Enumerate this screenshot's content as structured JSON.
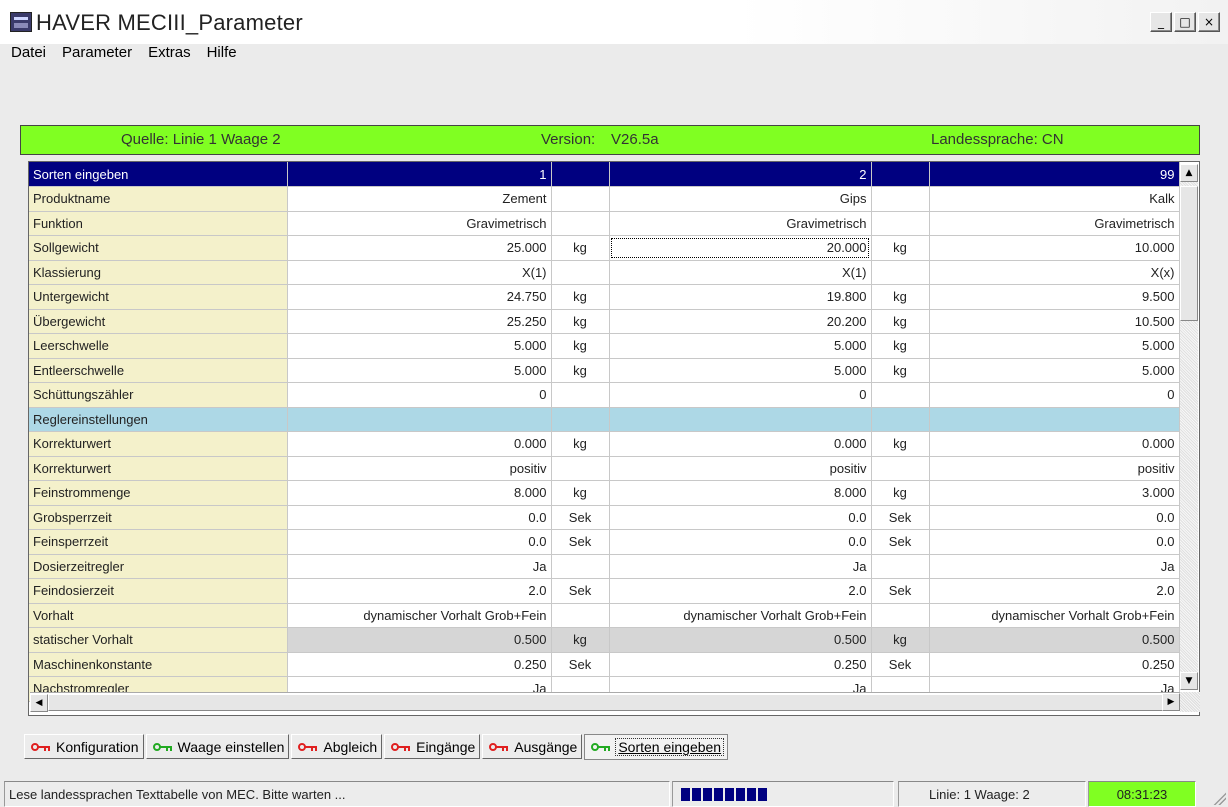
{
  "window": {
    "title": "HAVER MECIII_Parameter",
    "controls": [
      "_",
      "□",
      "×"
    ]
  },
  "menu": [
    "Datei",
    "Parameter",
    "Extras",
    "Hilfe"
  ],
  "info": {
    "source": "Quelle: Linie 1 Waage 2",
    "version_label": "Version:",
    "version_value": "V26.5a",
    "language": "Landessprache: CN",
    "color": "#80ff22"
  },
  "grid": {
    "header": {
      "label": "Sorten eingeben",
      "col1": "1",
      "col2": "2",
      "col3": "99"
    },
    "rows": [
      {
        "label": "Produktname",
        "v1": "Zement",
        "u1": "",
        "v2": "Gips",
        "u2": "",
        "v3": "Kalk"
      },
      {
        "label": "Funktion",
        "v1": "Gravimetrisch",
        "u1": "",
        "v2": "Gravimetrisch",
        "u2": "",
        "v3": "Gravimetrisch"
      },
      {
        "label": "Sollgewicht",
        "v1": "25.000",
        "u1": "kg",
        "v2": "20.000",
        "u2": "kg",
        "v3": "10.000"
      },
      {
        "label": "Klassierung",
        "v1": "X(1)",
        "u1": "",
        "v2": "X(1)",
        "u2": "",
        "v3": "X(x)"
      },
      {
        "label": "Untergewicht",
        "v1": "24.750",
        "u1": "kg",
        "v2": "19.800",
        "u2": "kg",
        "v3": "9.500"
      },
      {
        "label": "Übergewicht",
        "v1": "25.250",
        "u1": "kg",
        "v2": "20.200",
        "u2": "kg",
        "v3": "10.500"
      },
      {
        "label": "Leerschwelle",
        "v1": "5.000",
        "u1": "kg",
        "v2": "5.000",
        "u2": "kg",
        "v3": "5.000"
      },
      {
        "label": "Entleerschwelle",
        "v1": "5.000",
        "u1": "kg",
        "v2": "5.000",
        "u2": "kg",
        "v3": "5.000"
      },
      {
        "label": "Schüttungszähler",
        "v1": "0",
        "u1": "",
        "v2": "0",
        "u2": "",
        "v3": "0"
      },
      {
        "label": "Reglereinstellungen",
        "v1": "",
        "u1": "",
        "v2": "",
        "u2": "",
        "v3": ""
      },
      {
        "label": "Korrekturwert",
        "v1": "0.000",
        "u1": "kg",
        "v2": "0.000",
        "u2": "kg",
        "v3": "0.000"
      },
      {
        "label": "Korrekturwert",
        "v1": "positiv",
        "u1": "",
        "v2": "positiv",
        "u2": "",
        "v3": "positiv"
      },
      {
        "label": "Feinstrommenge",
        "v1": "8.000",
        "u1": "kg",
        "v2": "8.000",
        "u2": "kg",
        "v3": "3.000"
      },
      {
        "label": "Grobsperrzeit",
        "v1": "0.0",
        "u1": "Sek",
        "v2": "0.0",
        "u2": "Sek",
        "v3": "0.0"
      },
      {
        "label": "Feinsperrzeit",
        "v1": "0.0",
        "u1": "Sek",
        "v2": "0.0",
        "u2": "Sek",
        "v3": "0.0"
      },
      {
        "label": "Dosierzeitregler",
        "v1": "Ja",
        "u1": "",
        "v2": "Ja",
        "u2": "",
        "v3": "Ja"
      },
      {
        "label": "Feindosierzeit",
        "v1": "2.0",
        "u1": "Sek",
        "v2": "2.0",
        "u2": "Sek",
        "v3": "2.0"
      },
      {
        "label": "Vorhalt",
        "v1": "dynamischer Vorhalt Grob+Fein",
        "u1": "",
        "v2": "dynamischer Vorhalt Grob+Fein",
        "u2": "",
        "v3": "dynamischer Vorhalt Grob+Fein"
      },
      {
        "label": "statischer Vorhalt",
        "v1": "0.500",
        "u1": "kg",
        "v2": "0.500",
        "u2": "kg",
        "v3": "0.500"
      },
      {
        "label": "Maschinenkonstante",
        "v1": "0.250",
        "u1": "Sek",
        "v2": "0.250",
        "u2": "Sek",
        "v3": "0.250"
      },
      {
        "label": "Nachstromregler",
        "v1": "Ja",
        "u1": "",
        "v2": "Ja",
        "u2": "",
        "v3": "Ja"
      }
    ]
  },
  "tabs": [
    {
      "label": "Konfiguration",
      "icon": "key-red-icon"
    },
    {
      "label": "Waage einstellen",
      "icon": "key-green-icon"
    },
    {
      "label": "Abgleich",
      "icon": "key-red-icon"
    },
    {
      "label": "Eingänge",
      "icon": "key-red-icon"
    },
    {
      "label": "Ausgänge",
      "icon": "key-red-icon"
    },
    {
      "label": "Sorten eingeben",
      "icon": "key-green-icon",
      "active": true
    }
  ],
  "status": {
    "message": "Lese landessprachen Texttabelle von MEC. Bitte warten ...",
    "progress_blocks": 8,
    "location": "Linie: 1 Waage: 2",
    "time": "08:31:23"
  }
}
